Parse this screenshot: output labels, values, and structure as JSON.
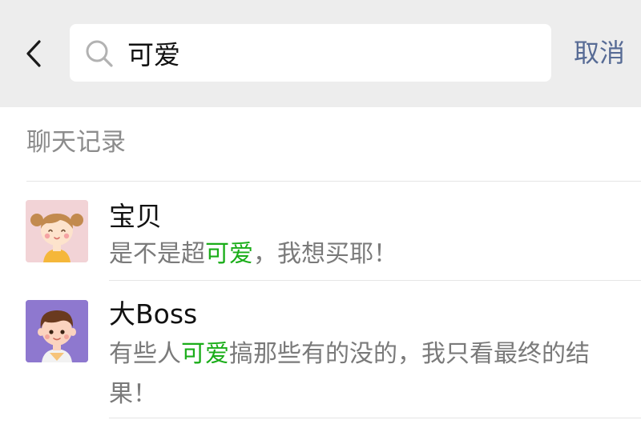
{
  "search": {
    "query": "可爱",
    "cancel_label": "取消"
  },
  "section": {
    "title": "聊天记录"
  },
  "results": [
    {
      "name": "宝贝",
      "message_before": "是不是超",
      "message_match": "可爱",
      "message_after": "，我想买耶！",
      "avatar_icon": "girl-avatar-icon"
    },
    {
      "name": "大Boss",
      "message_before": "有些人",
      "message_match": "可爱",
      "message_after": "搞那些有的没的，我只看最终的结果！",
      "avatar_icon": "boy-avatar-icon"
    }
  ],
  "colors": {
    "top_bar_bg": "#ededed",
    "cancel_link": "#576b95",
    "keyword_highlight": "#1aad19",
    "secondary_text": "#7a7a7a"
  }
}
